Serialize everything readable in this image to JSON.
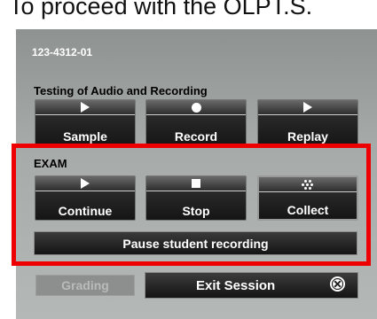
{
  "top_caption": "To proceed with the OLPT.S.",
  "session": {
    "id": "123-4312-01"
  },
  "audio_section": {
    "title": "Testing of Audio and Recording",
    "buttons": [
      {
        "label": "Sample",
        "icon": "play-icon"
      },
      {
        "label": "Record",
        "icon": "record-icon"
      },
      {
        "label": "Replay",
        "icon": "play-icon"
      }
    ]
  },
  "exam_section": {
    "title": "EXAM",
    "buttons": [
      {
        "label": "Continue",
        "icon": "play-icon"
      },
      {
        "label": "Stop",
        "icon": "stop-icon"
      },
      {
        "label": "Collect",
        "icon": "collect-dots-icon"
      }
    ],
    "pause_label": "Pause student recording"
  },
  "footer": {
    "grading_label": "Grading",
    "exit_label": "Exit Session",
    "exit_icon": "close-circle-icon"
  },
  "colors": {
    "highlight_border": "#ee0000",
    "panel_bg": "#a6aaa8",
    "button_bg": "#151515"
  }
}
